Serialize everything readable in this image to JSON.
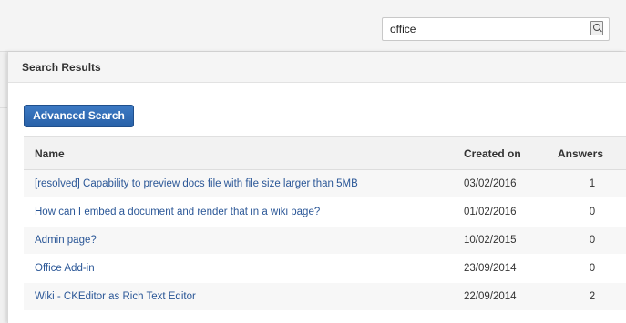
{
  "search": {
    "value": "office",
    "icon": "search-icon"
  },
  "panel": {
    "title": "Search Results",
    "advanced_search_label": "Advanced Search"
  },
  "table": {
    "headers": {
      "name": "Name",
      "created": "Created on",
      "answers": "Answers"
    },
    "rows": [
      {
        "name": "[resolved] Capability to preview docs file with file size larger than 5MB",
        "created": "03/02/2016",
        "answers": "1"
      },
      {
        "name": "How can I embed a document and render that in a wiki page?",
        "created": "01/02/2016",
        "answers": "0"
      },
      {
        "name": "Admin page?",
        "created": "10/02/2015",
        "answers": "0"
      },
      {
        "name": "Office Add-in",
        "created": "23/09/2014",
        "answers": "0"
      },
      {
        "name": "Wiki - CKEditor as Rich Text Editor",
        "created": "22/09/2014",
        "answers": "2"
      }
    ]
  },
  "colors": {
    "link": "#2b5797",
    "button": "#2d67b0",
    "header_bg": "#f5f5f5"
  }
}
